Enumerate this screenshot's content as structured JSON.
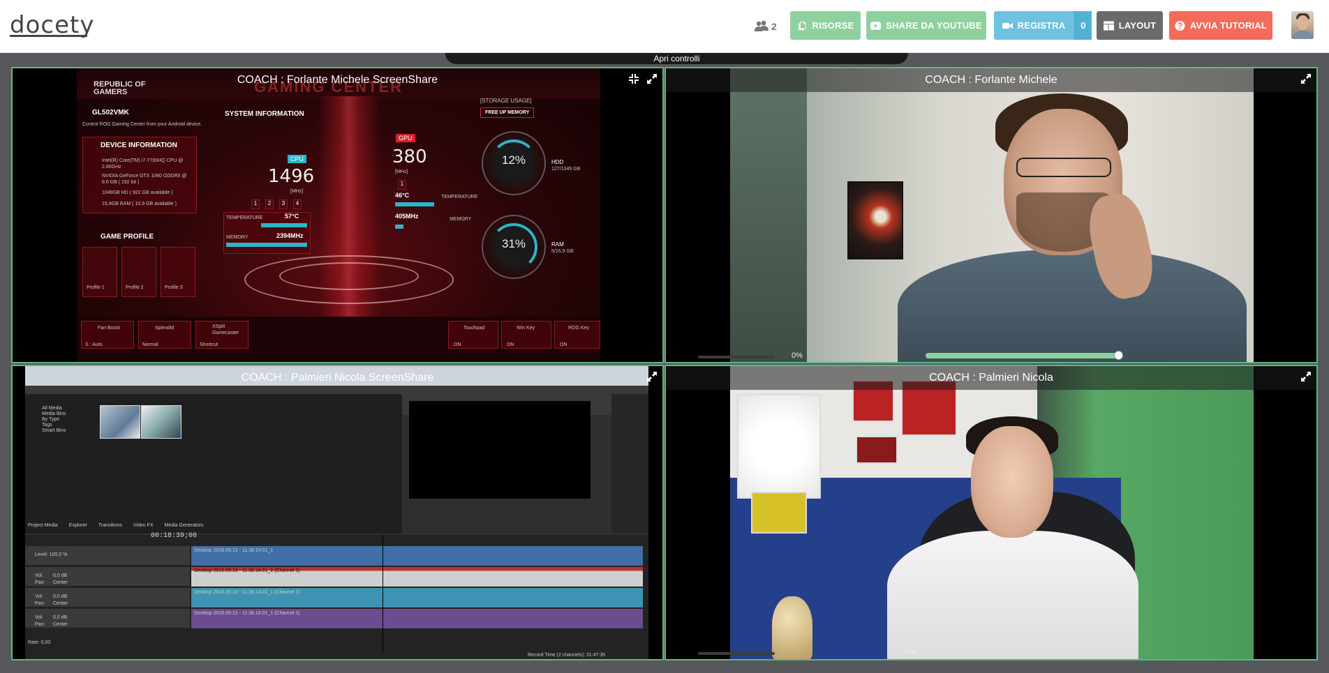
{
  "app": {
    "logo": "docety"
  },
  "header": {
    "participants_count": "2",
    "buttons": {
      "risorse": "RISORSE",
      "youtube": "SHARE DA YOUTUBE",
      "registra": "REGISTRA",
      "registra_count": "0",
      "layout": "LAYOUT",
      "tutorial": "AVVIA TUTORIAL"
    },
    "colors": {
      "green": "#8fd19e",
      "blue": "#6fc1e0",
      "grey": "#6a6a6a",
      "red": "#f26b5b"
    }
  },
  "controls_tab": "Apri controlli",
  "tiles": [
    {
      "title": "COACH : Forlante Michele ScreenShare"
    },
    {
      "title": "COACH : Forlante Michele",
      "progress": "0%",
      "volume_level": 0.83
    },
    {
      "title": "COACH : Palmieri Nicola ScreenShare"
    },
    {
      "title": "COACH : Palmieri Nicola",
      "progress": "0%"
    }
  ],
  "rog": {
    "brand": "REPUBLIC OF GAMERS",
    "title": "GAMING CENTER",
    "model": "GL502VMK",
    "android_note": "Control ROG Gaming Center from your Android device.",
    "system_info": "SYSTEM INFORMATION",
    "device_info": "DEVICE INFORMATION",
    "device_lines": [
      "Intel(R) Core(TM) i7-7700HQ CPU @ 2.80GHz",
      "NVIDIA GeForce GTX 1060 GDDR5 @ 6.0 GB ( 192 bit )",
      "1049GB HD ( 922 GB available )",
      "15,9GB RAM ( 10,9 GB available )"
    ],
    "game_profile": "GAME PROFILE",
    "profiles": [
      "Profile 1",
      "Profile 2",
      "Profile 3"
    ],
    "cpu_label": "CPU",
    "cpu_mhz": "1496",
    "mhz_unit": "[MHz]",
    "cpu_cores": [
      "1",
      "2",
      "3",
      "4"
    ],
    "cpu_temp_label": "TEMPERATURE",
    "cpu_temp": "57°C",
    "cpu_mem_label": "MEMORY",
    "cpu_mem": "2394MHz",
    "gpu_label": "GPU",
    "gpu_mhz": "380",
    "gpu_core": "1",
    "gpu_temp": "46°C",
    "gpu_temp_label": "TEMPERATURE",
    "gpu_mem": "405MHz",
    "gpu_mem_label": "MEMORY",
    "storage_label": "[STORAGE USAGE]",
    "free_memory": "FREE UP MEMORY",
    "hdd_pct": "12%",
    "hdd_label": "HDD",
    "hdd_value": "127/1049 GB",
    "ram_pct": "31%",
    "ram_label": "RAM",
    "ram_value": "5/15,9 GB",
    "bottom": [
      {
        "name": "Fan Boost",
        "value": "S : Auto"
      },
      {
        "name": "Splendid",
        "value": "Normal"
      },
      {
        "name": "XSplit Gamecaster",
        "value": "Shortcut"
      },
      {
        "name": "Touchpad",
        "value": "ON"
      },
      {
        "name": "Win Key",
        "value": "ON"
      },
      {
        "name": "ROG Key",
        "value": "ON"
      }
    ]
  },
  "vegas": {
    "timecode": "00:18:39;00",
    "media_tree": [
      "All Media",
      "Media Bins",
      "By Type",
      "Tags",
      "Smart Bins"
    ],
    "tabs": [
      "Project Media",
      "Explorer",
      "Transitions",
      "Video FX",
      "Media Generators"
    ],
    "track_labels": [
      "Desktop 2016.09.13 - 11.38.14.01_1",
      "Desktop 2016.09.13 - 11.38.14.01_1 (Channel 1)",
      "Desktop 2016.09.13 - 11.38.14.01_1 (Channel 2)",
      "Desktop 2016.09.13 - 11.38.14.01_1 (Channel 3)"
    ],
    "vol_label": "Vol:",
    "vol_value": "0,0 dB",
    "pan_label": "Pan:",
    "pan_value": "Center",
    "level_label": "Level: 100,0 %",
    "rate_label": "Rate: 0,00",
    "record_time": "Record Time (2 channels): 31:47:35"
  }
}
